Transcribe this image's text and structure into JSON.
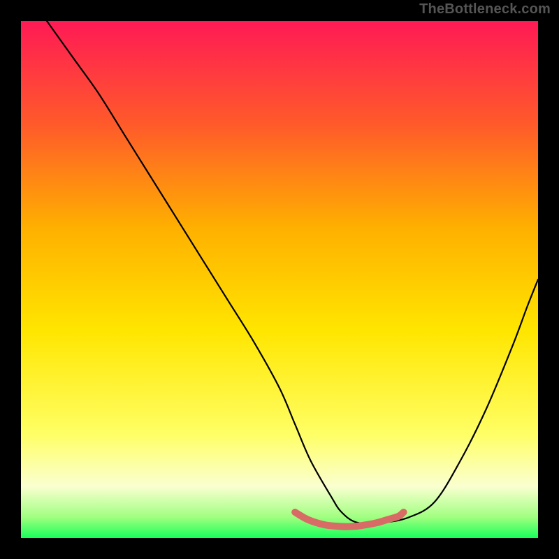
{
  "watermark": "TheBottleneck.com",
  "chart_data": {
    "type": "line",
    "title": "",
    "xlabel": "",
    "ylabel": "",
    "xlim": [
      0,
      100
    ],
    "ylim": [
      0,
      100
    ],
    "grid": false,
    "legend": false,
    "gradient_stops": [
      {
        "pos": 0.0,
        "color": "#ff1a55"
      },
      {
        "pos": 0.2,
        "color": "#ff5a2a"
      },
      {
        "pos": 0.4,
        "color": "#ffb000"
      },
      {
        "pos": 0.6,
        "color": "#ffe600"
      },
      {
        "pos": 0.8,
        "color": "#ffff66"
      },
      {
        "pos": 0.9,
        "color": "#faffd0"
      },
      {
        "pos": 0.96,
        "color": "#a0ff80"
      },
      {
        "pos": 1.0,
        "color": "#17ff59"
      }
    ],
    "series": [
      {
        "name": "bottleneck-curve",
        "color": "#000000",
        "width": 2.2,
        "x": [
          5,
          10,
          15,
          20,
          25,
          30,
          35,
          40,
          45,
          50,
          53,
          56,
          60,
          62,
          65,
          70,
          75,
          80,
          85,
          90,
          95,
          98,
          100
        ],
        "y": [
          100,
          93,
          86,
          78,
          70,
          62,
          54,
          46,
          38,
          29,
          22,
          15,
          8,
          5,
          3,
          3,
          4,
          7,
          15,
          25,
          37,
          45,
          50
        ]
      },
      {
        "name": "optimal-zone",
        "color": "#d86b66",
        "width": 10,
        "x": [
          53,
          55,
          57,
          59,
          61,
          63,
          65,
          67,
          69,
          71,
          73,
          74
        ],
        "y": [
          5,
          3.8,
          3.0,
          2.5,
          2.3,
          2.2,
          2.3,
          2.6,
          3.0,
          3.6,
          4.2,
          5
        ]
      }
    ]
  }
}
